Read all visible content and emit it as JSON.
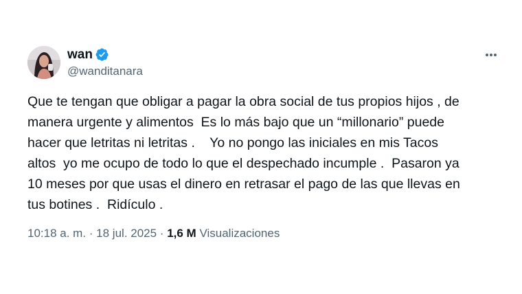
{
  "tweet": {
    "display_name": "wan",
    "handle": "@wanditanara",
    "verified_icon": "verified-badge-icon",
    "more_icon": "more-options-icon",
    "lines": [
      "Que te tengan que obligar a pagar la obra social de tus propios hijos , de",
      "manera urgente y alimentos  Es lo más bajo que un “millonario” puede",
      "hacer que letritas ni letritas .    Yo no pongo las iniciales en mis Tacos",
      "altos  yo me ocupo de todo lo que el despechado incumple .  Pasaron ya",
      "10 meses por que usas el dinero en retrasar el pago de las que llevas en",
      "tus botines .  Ridículo ."
    ],
    "time": "10:18 a. m.",
    "separator": " · ",
    "date": "18 jul. 2025",
    "views_count": "1,6 M",
    "views_label": "Visualizaciones"
  },
  "colors": {
    "verified_blue": "#1d9bf0",
    "text_primary": "#0f1419",
    "text_secondary": "#536471"
  }
}
